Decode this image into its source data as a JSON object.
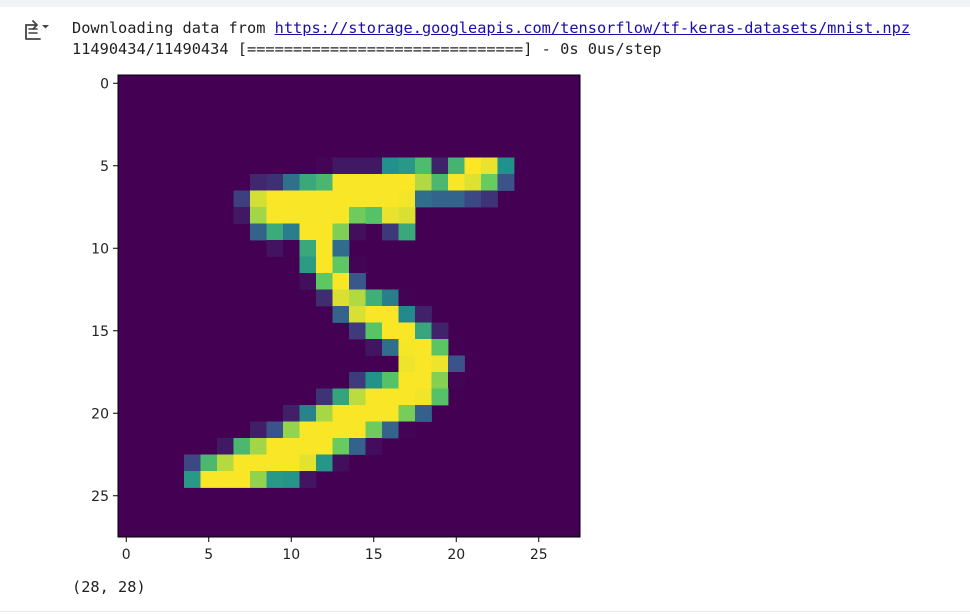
{
  "output": {
    "download_prefix": "Downloading data from ",
    "download_url": "https://storage.googleapis.com/tensorflow/tf-keras-datasets/mnist.npz",
    "progress_line": "11490434/11490434 [==============================] - 0s 0us/step",
    "shape_text": "(28, 28)"
  },
  "icons": {
    "output_toggle": "output-collapse-icon"
  },
  "chart_data": {
    "type": "heatmap",
    "title": "",
    "xlabel": "",
    "ylabel": "",
    "colormap": "viridis",
    "xlim": [
      -0.5,
      27.5
    ],
    "ylim": [
      27.5,
      -0.5
    ],
    "xticks": [
      0,
      5,
      10,
      15,
      20,
      25
    ],
    "yticks": [
      0,
      5,
      10,
      15,
      20,
      25
    ],
    "vmin": 0,
    "vmax": 255,
    "shape": [
      28,
      28
    ],
    "values": [
      [
        0,
        0,
        0,
        0,
        0,
        0,
        0,
        0,
        0,
        0,
        0,
        0,
        0,
        0,
        0,
        0,
        0,
        0,
        0,
        0,
        0,
        0,
        0,
        0,
        0,
        0,
        0,
        0
      ],
      [
        0,
        0,
        0,
        0,
        0,
        0,
        0,
        0,
        0,
        0,
        0,
        0,
        0,
        0,
        0,
        0,
        0,
        0,
        0,
        0,
        0,
        0,
        0,
        0,
        0,
        0,
        0,
        0
      ],
      [
        0,
        0,
        0,
        0,
        0,
        0,
        0,
        0,
        0,
        0,
        0,
        0,
        0,
        0,
        0,
        0,
        0,
        0,
        0,
        0,
        0,
        0,
        0,
        0,
        0,
        0,
        0,
        0
      ],
      [
        0,
        0,
        0,
        0,
        0,
        0,
        0,
        0,
        0,
        0,
        0,
        0,
        0,
        0,
        0,
        0,
        0,
        0,
        0,
        0,
        0,
        0,
        0,
        0,
        0,
        0,
        0,
        0
      ],
      [
        0,
        0,
        0,
        0,
        0,
        0,
        0,
        0,
        0,
        0,
        0,
        0,
        0,
        0,
        0,
        0,
        0,
        0,
        0,
        0,
        0,
        0,
        0,
        0,
        0,
        0,
        0,
        0
      ],
      [
        0,
        0,
        0,
        0,
        0,
        0,
        0,
        0,
        0,
        0,
        0,
        0,
        3,
        18,
        18,
        18,
        126,
        136,
        175,
        26,
        166,
        255,
        247,
        127,
        0,
        0,
        0,
        0
      ],
      [
        0,
        0,
        0,
        0,
        0,
        0,
        0,
        0,
        30,
        36,
        94,
        154,
        170,
        253,
        253,
        253,
        253,
        253,
        225,
        172,
        253,
        242,
        195,
        64,
        0,
        0,
        0,
        0
      ],
      [
        0,
        0,
        0,
        0,
        0,
        0,
        0,
        49,
        238,
        253,
        253,
        253,
        253,
        253,
        253,
        253,
        253,
        251,
        93,
        82,
        82,
        56,
        39,
        0,
        0,
        0,
        0,
        0
      ],
      [
        0,
        0,
        0,
        0,
        0,
        0,
        0,
        18,
        219,
        253,
        253,
        253,
        253,
        253,
        198,
        182,
        247,
        241,
        0,
        0,
        0,
        0,
        0,
        0,
        0,
        0,
        0,
        0
      ],
      [
        0,
        0,
        0,
        0,
        0,
        0,
        0,
        0,
        80,
        156,
        107,
        253,
        253,
        205,
        11,
        0,
        43,
        154,
        0,
        0,
        0,
        0,
        0,
        0,
        0,
        0,
        0,
        0
      ],
      [
        0,
        0,
        0,
        0,
        0,
        0,
        0,
        0,
        0,
        14,
        1,
        154,
        253,
        90,
        0,
        0,
        0,
        0,
        0,
        0,
        0,
        0,
        0,
        0,
        0,
        0,
        0,
        0
      ],
      [
        0,
        0,
        0,
        0,
        0,
        0,
        0,
        0,
        0,
        0,
        0,
        139,
        253,
        190,
        2,
        0,
        0,
        0,
        0,
        0,
        0,
        0,
        0,
        0,
        0,
        0,
        0,
        0
      ],
      [
        0,
        0,
        0,
        0,
        0,
        0,
        0,
        0,
        0,
        0,
        0,
        11,
        190,
        253,
        70,
        0,
        0,
        0,
        0,
        0,
        0,
        0,
        0,
        0,
        0,
        0,
        0,
        0
      ],
      [
        0,
        0,
        0,
        0,
        0,
        0,
        0,
        0,
        0,
        0,
        0,
        0,
        35,
        241,
        225,
        160,
        108,
        1,
        0,
        0,
        0,
        0,
        0,
        0,
        0,
        0,
        0,
        0
      ],
      [
        0,
        0,
        0,
        0,
        0,
        0,
        0,
        0,
        0,
        0,
        0,
        0,
        0,
        81,
        240,
        253,
        253,
        119,
        25,
        0,
        0,
        0,
        0,
        0,
        0,
        0,
        0,
        0
      ],
      [
        0,
        0,
        0,
        0,
        0,
        0,
        0,
        0,
        0,
        0,
        0,
        0,
        0,
        0,
        45,
        186,
        253,
        253,
        150,
        27,
        0,
        0,
        0,
        0,
        0,
        0,
        0,
        0
      ],
      [
        0,
        0,
        0,
        0,
        0,
        0,
        0,
        0,
        0,
        0,
        0,
        0,
        0,
        0,
        0,
        16,
        93,
        252,
        253,
        187,
        0,
        0,
        0,
        0,
        0,
        0,
        0,
        0
      ],
      [
        0,
        0,
        0,
        0,
        0,
        0,
        0,
        0,
        0,
        0,
        0,
        0,
        0,
        0,
        0,
        0,
        0,
        249,
        253,
        249,
        64,
        0,
        0,
        0,
        0,
        0,
        0,
        0
      ],
      [
        0,
        0,
        0,
        0,
        0,
        0,
        0,
        0,
        0,
        0,
        0,
        0,
        0,
        0,
        46,
        130,
        183,
        253,
        253,
        207,
        2,
        0,
        0,
        0,
        0,
        0,
        0,
        0
      ],
      [
        0,
        0,
        0,
        0,
        0,
        0,
        0,
        0,
        0,
        0,
        0,
        0,
        39,
        148,
        229,
        253,
        253,
        253,
        250,
        182,
        0,
        0,
        0,
        0,
        0,
        0,
        0,
        0
      ],
      [
        0,
        0,
        0,
        0,
        0,
        0,
        0,
        0,
        0,
        0,
        24,
        114,
        221,
        253,
        253,
        253,
        253,
        201,
        78,
        0,
        0,
        0,
        0,
        0,
        0,
        0,
        0,
        0
      ],
      [
        0,
        0,
        0,
        0,
        0,
        0,
        0,
        0,
        23,
        66,
        213,
        253,
        253,
        253,
        253,
        198,
        81,
        2,
        0,
        0,
        0,
        0,
        0,
        0,
        0,
        0,
        0,
        0
      ],
      [
        0,
        0,
        0,
        0,
        0,
        0,
        18,
        171,
        219,
        253,
        253,
        253,
        253,
        195,
        80,
        9,
        0,
        0,
        0,
        0,
        0,
        0,
        0,
        0,
        0,
        0,
        0,
        0
      ],
      [
        0,
        0,
        0,
        0,
        55,
        172,
        226,
        253,
        253,
        253,
        253,
        244,
        133,
        11,
        0,
        0,
        0,
        0,
        0,
        0,
        0,
        0,
        0,
        0,
        0,
        0,
        0,
        0
      ],
      [
        0,
        0,
        0,
        0,
        136,
        253,
        253,
        253,
        212,
        135,
        132,
        16,
        0,
        0,
        0,
        0,
        0,
        0,
        0,
        0,
        0,
        0,
        0,
        0,
        0,
        0,
        0,
        0
      ],
      [
        0,
        0,
        0,
        0,
        0,
        0,
        0,
        0,
        0,
        0,
        0,
        0,
        0,
        0,
        0,
        0,
        0,
        0,
        0,
        0,
        0,
        0,
        0,
        0,
        0,
        0,
        0,
        0
      ],
      [
        0,
        0,
        0,
        0,
        0,
        0,
        0,
        0,
        0,
        0,
        0,
        0,
        0,
        0,
        0,
        0,
        0,
        0,
        0,
        0,
        0,
        0,
        0,
        0,
        0,
        0,
        0,
        0
      ],
      [
        0,
        0,
        0,
        0,
        0,
        0,
        0,
        0,
        0,
        0,
        0,
        0,
        0,
        0,
        0,
        0,
        0,
        0,
        0,
        0,
        0,
        0,
        0,
        0,
        0,
        0,
        0,
        0
      ]
    ]
  }
}
